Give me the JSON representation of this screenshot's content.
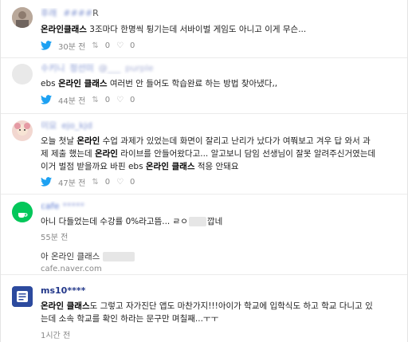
{
  "posts": [
    {
      "author_visible": "R",
      "text_parts": [
        {
          "t": "온라인클래스",
          "b": true
        },
        {
          "t": " 3조마다 한명씩 튕기는데 서바이벌 게임도 아니고 이게 무슨...",
          "b": false
        }
      ],
      "time": "30분 전",
      "retweets": "0",
      "likes": "0"
    },
    {
      "author_visible": "purple",
      "text_parts": [
        {
          "t": "ebs ",
          "b": false
        },
        {
          "t": "온라인 클래스",
          "b": true
        },
        {
          "t": " 여러번 안 들어도 학습완료 하는 방법 찾아냈다,,",
          "b": false
        }
      ],
      "time": "44분 전",
      "retweets": "0",
      "likes": "0"
    },
    {
      "author_visible": "ejo_kjd",
      "text_lines": [
        [
          {
            "t": "오늘 첫날 ",
            "b": false
          },
          {
            "t": "온라인",
            "b": true
          },
          {
            "t": " 수업 과제가 있었는데 화면이 잘리고 난리가 났다가 여쭤보고 겨우 답 와서 과",
            "b": false
          }
        ],
        [
          {
            "t": "제 제출 했는데 ",
            "b": false
          },
          {
            "t": "온라인",
            "b": true
          },
          {
            "t": " 라이브를 안들어왔다고... 알고보니 담임 선생님이 잘못 알려주신거였는데",
            "b": false
          }
        ],
        [
          {
            "t": "이거 벌점 받을까요 바핀 ebs ",
            "b": false
          },
          {
            "t": "온라인 클래스",
            "b": true
          },
          {
            "t": " 적응 안돼요",
            "b": false
          }
        ]
      ],
      "time": "47분 전",
      "retweets": "0",
      "likes": "0"
    },
    {
      "author_visible": "cafe",
      "text_parts": [
        {
          "t": "아니 다들었는데 수강률 0%라고뜸... ㄹㅇ",
          "b": false
        },
        {
          "t": "깝네",
          "b": false
        }
      ],
      "time": "55분 전",
      "cafe_title": "아 온라인 클래스",
      "cafe_url": "cafe.naver.com"
    },
    {
      "author_visible": "ms10****",
      "text_lines": [
        [
          {
            "t": "온라인 클래스",
            "b": true
          },
          {
            "t": "도 그렇고 자가진단 앱도 마찬가지!!!아이가 학교에 입학식도 하고 학교 다니고 있",
            "b": false
          }
        ],
        [
          {
            "t": "는데 소속 학교를 확인 하라는 문구만 며칠째...ㅜㅜ",
            "b": false
          }
        ]
      ],
      "time": "1시간 전"
    }
  ],
  "colors": {
    "twitter_blue": "#1da1f2",
    "author_blue": "#3a5fc8",
    "cafe_green": "#03c75a",
    "ms_avatar": "#2c4a9e"
  },
  "icons": {
    "twitter": "twitter-bird-icon",
    "retweet": "retweet-icon",
    "like": "heart-icon"
  }
}
